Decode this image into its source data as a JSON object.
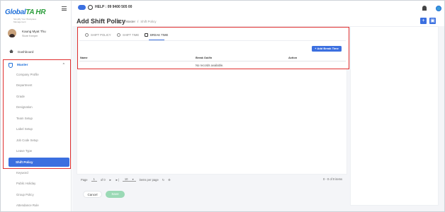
{
  "brand": {
    "name_main": "Global",
    "name_accent": "TA HR",
    "tagline": "Simplify Your Workplace Management"
  },
  "profile": {
    "name": "Kaung Myat Thu",
    "role": "Store Keeper"
  },
  "sidebar": {
    "dashboard": "Dashboard",
    "master": "Master",
    "sub_items": [
      "Company Profile",
      "Department",
      "Grade",
      "Designation",
      "Team Setup",
      "Label Setup",
      "Job Code Setup",
      "Leave Type",
      "Shift Policy",
      "Keyword",
      "Public Holiday",
      "Group Policy",
      "Attendance Rule"
    ],
    "active_item": "Shift Policy"
  },
  "topbar": {
    "help": "HELP : 09 9400 505 00"
  },
  "header": {
    "title": "Add Shift Policy",
    "breadcrumb": [
      "Master",
      "Shift Policy"
    ]
  },
  "tabs": [
    {
      "label": "SHIFT POLICY",
      "icon": "policy-icon"
    },
    {
      "label": "SHIFT TIME",
      "icon": "clock-icon"
    },
    {
      "label": "BREAK TIME",
      "icon": "coffee-icon",
      "active": true
    }
  ],
  "table": {
    "add_button": "+ Add Break Time",
    "headers": [
      "Name",
      "Break Out/In",
      "Action"
    ],
    "empty": "No records available."
  },
  "pager": {
    "page_label": "Page",
    "page": "1",
    "of": "of 0",
    "per_page": "10",
    "items_per_page": "items per page",
    "info": "0 - 0 of 0 items"
  },
  "actions": {
    "cancel": "Cancel",
    "save": "Save"
  },
  "colors": {
    "accent": "#3b6fe0",
    "highlight": "#e03030",
    "save_disabled": "#9ad9b5"
  }
}
